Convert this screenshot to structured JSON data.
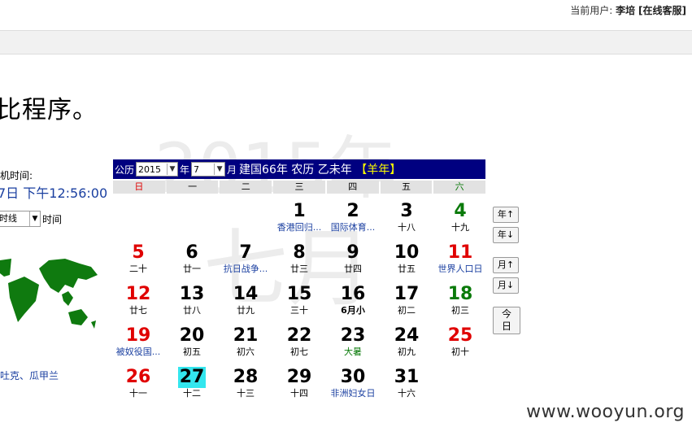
{
  "topbar": {
    "user_label": "当前用户:",
    "user_name": "李培",
    "service_link": "[在线客服]"
  },
  "main": {
    "heading": "比程序。"
  },
  "watermark": {
    "year": "2015年",
    "month": "七月"
  },
  "clock": {
    "label": "机时间:",
    "time": "7日 下午12:56:00",
    "tz_value": "时线",
    "tz_label": "时间"
  },
  "world": {
    "countries": "吐克、瓜甲兰"
  },
  "calendar": {
    "calendar_type": "公历",
    "year": "2015",
    "year_unit": "年",
    "month": "7",
    "month_unit": "月",
    "lunar": "建国66年 农历 乙未年",
    "zodiac": "【羊年】",
    "weekdays": [
      "日",
      "一",
      "二",
      "三",
      "四",
      "五",
      "六"
    ],
    "weeks": [
      [
        null,
        null,
        null,
        {
          "n": "1",
          "s": "香港回归..."
        },
        {
          "n": "2",
          "s": "国际体育..."
        },
        {
          "n": "3",
          "s": "十八"
        },
        {
          "n": "4",
          "s": "十九"
        }
      ],
      [
        {
          "n": "5",
          "s": "二十"
        },
        {
          "n": "6",
          "s": "廿一"
        },
        {
          "n": "7",
          "s": "抗日战争..."
        },
        {
          "n": "8",
          "s": "廿三"
        },
        {
          "n": "9",
          "s": "廿四"
        },
        {
          "n": "10",
          "s": "廿五"
        },
        {
          "n": "11",
          "s": "世界人口日"
        }
      ],
      [
        {
          "n": "12",
          "s": "廿七"
        },
        {
          "n": "13",
          "s": "廿八"
        },
        {
          "n": "14",
          "s": "廿九"
        },
        {
          "n": "15",
          "s": "三十"
        },
        {
          "n": "16",
          "s": "6月小"
        },
        {
          "n": "17",
          "s": "初二"
        },
        {
          "n": "18",
          "s": "初三"
        }
      ],
      [
        {
          "n": "19",
          "s": "被奴役国..."
        },
        {
          "n": "20",
          "s": "初五"
        },
        {
          "n": "21",
          "s": "初六"
        },
        {
          "n": "22",
          "s": "初七"
        },
        {
          "n": "23",
          "s": "大暑"
        },
        {
          "n": "24",
          "s": "初九"
        },
        {
          "n": "25",
          "s": "初十"
        }
      ],
      [
        {
          "n": "26",
          "s": "十一"
        },
        {
          "n": "27",
          "s": "十二",
          "today": true
        },
        {
          "n": "28",
          "s": "十三"
        },
        {
          "n": "29",
          "s": "十四"
        },
        {
          "n": "30",
          "s": "非洲妇女日"
        },
        {
          "n": "31",
          "s": "十六"
        },
        null
      ]
    ],
    "buttons": {
      "year_up": "年↑",
      "year_down": "年↓",
      "month_up": "月↑",
      "month_down": "月↓",
      "today": "今日"
    }
  },
  "colors": {
    "header_bg": "#000080",
    "zodiac": "#ffff00",
    "weekend_red": "#e00000",
    "saturday_green": "#0a7a0a",
    "today_bg": "#33e6ee",
    "festival_navy": "#1a3fa0"
  },
  "footer": {
    "watermark": "www.wooyun.org"
  }
}
